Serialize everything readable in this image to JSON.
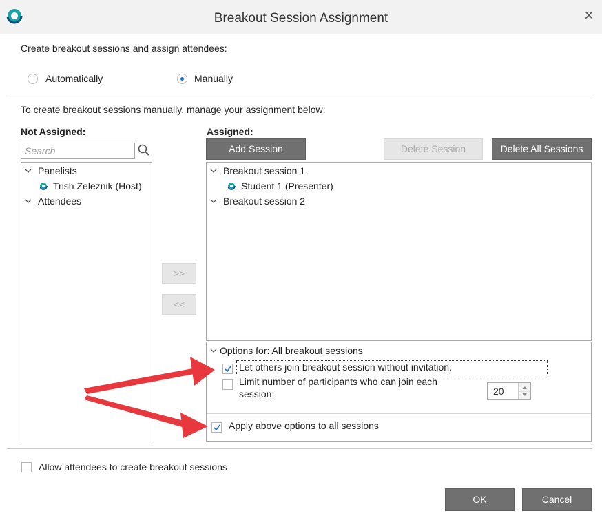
{
  "window": {
    "title": "Breakout Session Assignment",
    "close_glyph": "×"
  },
  "mode": {
    "prompt": "Create breakout sessions and assign attendees:",
    "options": [
      {
        "label": "Automatically",
        "selected": false
      },
      {
        "label": "Manually",
        "selected": true
      }
    ]
  },
  "instructions": "To create breakout sessions manually, manage your assignment below:",
  "not_assigned": {
    "heading": "Not Assigned:",
    "search_placeholder": "Search",
    "tree": [
      {
        "label": "Panelists",
        "type": "group",
        "expanded": true
      },
      {
        "label": "Trish Zeleznik (Host)",
        "type": "person",
        "icon": "participant-status-icon"
      },
      {
        "label": "Attendees",
        "type": "group",
        "expanded": true
      }
    ]
  },
  "transfer": {
    "move_right": ">>",
    "move_left": "<<"
  },
  "assigned": {
    "heading": "Assigned:",
    "add_session": "Add Session",
    "delete_session": "Delete Session",
    "delete_all_sessions": "Delete All Sessions",
    "tree": [
      {
        "label": "Breakout session 1",
        "type": "group",
        "expanded": true
      },
      {
        "label": "Student 1 (Presenter)",
        "type": "person",
        "icon": "participant-status-icon"
      },
      {
        "label": "Breakout session 2",
        "type": "group",
        "expanded": true
      }
    ]
  },
  "options": {
    "heading": "Options for: All breakout sessions",
    "let_others_join": {
      "label": "Let others join breakout session without invitation.",
      "checked": true
    },
    "limit_participants": {
      "label_line1": "Limit number of participants who can join each",
      "label_line2": "session:",
      "checked": false,
      "value": "20"
    },
    "apply_all": {
      "label": "Apply above options to all sessions",
      "checked": true
    }
  },
  "allow_attendees": {
    "label": "Allow attendees to create breakout sessions",
    "checked": false
  },
  "footer": {
    "ok": "OK",
    "cancel": "Cancel"
  },
  "colors": {
    "accent": "#1f6fd1",
    "button_dark": "#707070",
    "annotation_arrow": "#e8383d"
  }
}
